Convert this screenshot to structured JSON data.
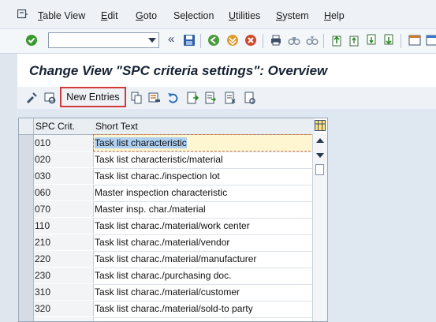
{
  "menu": {
    "items": [
      {
        "label": "Table View",
        "u": "T"
      },
      {
        "label": "Edit",
        "u": "E"
      },
      {
        "label": "Goto",
        "u": "G"
      },
      {
        "label": "Selection",
        "u": "l"
      },
      {
        "label": "Utilities",
        "u": "U"
      },
      {
        "label": "System",
        "u": "S"
      },
      {
        "label": "Help",
        "u": "H"
      }
    ]
  },
  "toolbar": {
    "command_value": ""
  },
  "page": {
    "title": "Change View \"SPC criteria settings\": Overview"
  },
  "apptoolbar": {
    "new_entries_label": "New Entries"
  },
  "table": {
    "headers": {
      "code": "SPC Crit.",
      "text": "Short Text"
    },
    "rows": [
      {
        "code": "010",
        "text": "Task list characteristic"
      },
      {
        "code": "020",
        "text": "Task list characteristic/material"
      },
      {
        "code": "030",
        "text": "Task list charac./inspection lot"
      },
      {
        "code": "060",
        "text": "Master inspection characteristic"
      },
      {
        "code": "070",
        "text": "Master insp. char./material"
      },
      {
        "code": "110",
        "text": "Task list charac./material/work center"
      },
      {
        "code": "210",
        "text": "Task list charac./material/vendor"
      },
      {
        "code": "220",
        "text": "Task list charac./material/manufacturer"
      },
      {
        "code": "230",
        "text": "Task list charac./purchasing doc."
      },
      {
        "code": "310",
        "text": "Task list charac./material/customer"
      },
      {
        "code": "320",
        "text": "Task list charac./material/sold-to party"
      }
    ]
  },
  "colors": {
    "highlight_border": "#d23a3a",
    "selection": "#aecff0"
  }
}
